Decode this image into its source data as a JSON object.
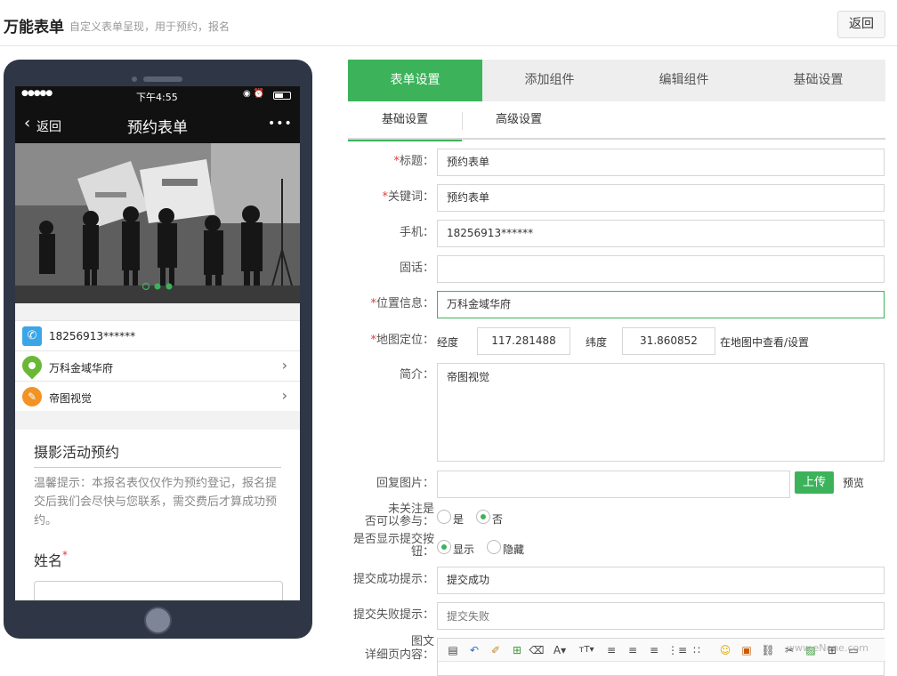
{
  "header": {
    "title": "万能表单",
    "subtitle": "自定义表单呈现，用于预约，报名",
    "back": "返回"
  },
  "phone": {
    "status": {
      "signal": "●●●●●",
      "time": "下午4:55",
      "icons": "◉ ⏰"
    },
    "nav": {
      "back": "返回",
      "title": "预约表单",
      "more": "•••"
    },
    "info": [
      {
        "icon": "phone-icon",
        "text": "18256913******"
      },
      {
        "icon": "location-icon",
        "text": "万科金域华府"
      },
      {
        "icon": "pencil-icon",
        "text": "帝图视觉"
      }
    ],
    "card": {
      "title": "摄影活动预约",
      "notice": "温馨提示：本报名表仅仅作为预约登记，报名提交后我们会尽快与您联系，需交费后才算成功预约。",
      "field_label": "姓名",
      "required_mark": "*"
    }
  },
  "tabs": [
    "表单设置",
    "添加组件",
    "编辑组件",
    "基础设置"
  ],
  "subtabs": [
    "基础设置",
    "高级设置"
  ],
  "form": {
    "title": {
      "label": "标题：",
      "value": "预约表单"
    },
    "keyword": {
      "label": "关键词：",
      "value": "预约表单"
    },
    "mobile": {
      "label": "手机：",
      "value": "18256913******"
    },
    "landline": {
      "label": "固话：",
      "value": ""
    },
    "location": {
      "label": "位置信息：",
      "value": "万科金域华府"
    },
    "map": {
      "label": "地图定位：",
      "lng_label": "经度",
      "lng": "117.281488",
      "lat_label": "纬度",
      "lat": "31.860852",
      "link": "在地图中查看/设置"
    },
    "intro": {
      "label": "简介：",
      "value": "帝图视觉"
    },
    "reply_image": {
      "label": "回复图片：",
      "upload": "上传",
      "preview": "预览"
    },
    "unfollowed": {
      "label_line1": "未关注是",
      "label_line2": "否可以参与：",
      "yes": "是",
      "no": "否"
    },
    "show_submit": {
      "label_line1": "是否显示提交按",
      "label_line2": "钮：",
      "show": "显示",
      "hide": "隐藏"
    },
    "success": {
      "label": "提交成功提示：",
      "value": "提交成功"
    },
    "fail": {
      "label": "提交失败提示：",
      "placeholder": "提交失败"
    },
    "detail": {
      "label_line1": "图文",
      "label_line2": "详细页内容："
    }
  },
  "watermark": "www.eNone.com"
}
